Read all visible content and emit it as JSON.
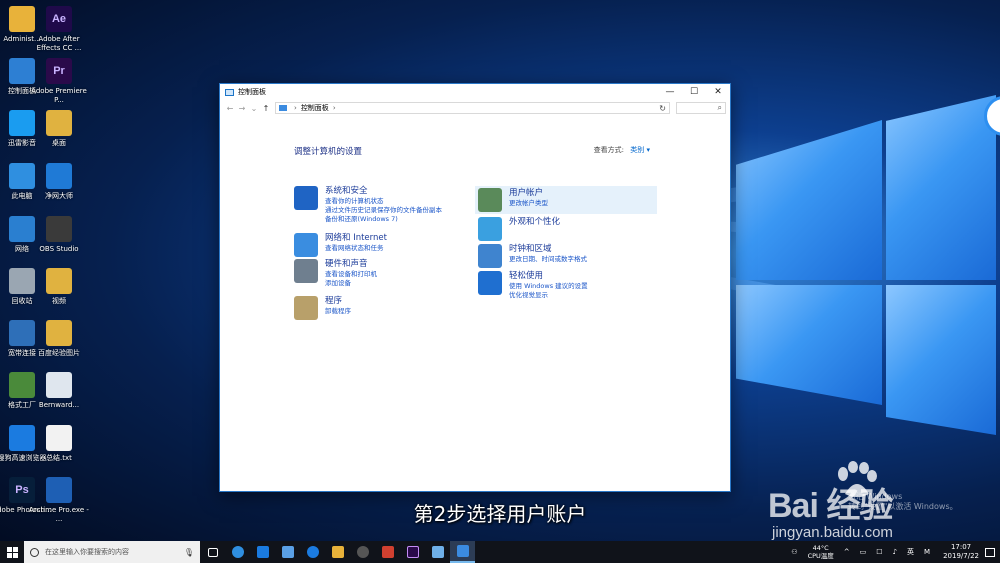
{
  "desktop": {
    "icons": [
      {
        "label": "Administ...",
        "color": "#e8b23a"
      },
      {
        "label": "Adobe After Effects CC ...",
        "glyph": "Ae",
        "color": "#1f0a4a"
      },
      {
        "label": "控制面板",
        "color": "#2d7fd3"
      },
      {
        "label": "Adobe Premiere P...",
        "glyph": "Pr",
        "color": "#2a0a4a"
      },
      {
        "label": "迅雷影音",
        "color": "#1a9cf0"
      },
      {
        "label": "桌面",
        "color": "#e0b240"
      },
      {
        "label": "此电脑",
        "color": "#2f8fe0"
      },
      {
        "label": "净网大师",
        "color": "#1f7ad6"
      },
      {
        "label": "网络",
        "color": "#2a7fd0"
      },
      {
        "label": "OBS Studio",
        "color": "#3a3a3a"
      },
      {
        "label": "回收站",
        "color": "#9aa6b2"
      },
      {
        "label": "视频",
        "color": "#e0b240"
      },
      {
        "label": "宽带连接",
        "color": "#2e6fb8"
      },
      {
        "label": "百度经验图片",
        "color": "#e0b240"
      },
      {
        "label": "格式工厂",
        "color": "#4a8a3a"
      },
      {
        "label": "Bernward...",
        "color": "#dfe6ee"
      },
      {
        "label": "搜狗高速浏览器",
        "color": "#1b7be0"
      },
      {
        "label": "总结.txt",
        "color": "#f2f2f2"
      },
      {
        "label": "Adobe Photosh...",
        "glyph": "Ps",
        "color": "#061e3a"
      },
      {
        "label": "Arctime Pro.exe - ...",
        "color": "#1e5fb4"
      }
    ]
  },
  "window": {
    "title": "控制面板",
    "controls": {
      "minimize": "—",
      "maximize": "☐",
      "close": "✕"
    },
    "address": {
      "path": "控制面板",
      "refresh": "↻",
      "search_glyph": "⌕"
    },
    "heading": "调整计算机的设置",
    "view_by": {
      "label": "查看方式:",
      "value": "类别 ▾"
    },
    "categories_left": [
      {
        "title": "系统和安全",
        "links": [
          "查看你的计算机状态",
          "通过文件历史记录保存你的文件备份副本",
          "备份和还原(Windows 7)"
        ],
        "color": "#1f64c4"
      },
      {
        "title": "网络和 Internet",
        "links": [
          "查看网络状态和任务"
        ],
        "color": "#3a8de0"
      },
      {
        "title": "硬件和声音",
        "links": [
          "查看设备和打印机",
          "添加设备"
        ],
        "color": "#6f7f8f"
      },
      {
        "title": "程序",
        "links": [
          "卸载程序"
        ],
        "color": "#b8a06a"
      }
    ],
    "categories_right": [
      {
        "title": "用户帐户",
        "links": [
          "更改帐户类型"
        ],
        "color": "#5a8a5a"
      },
      {
        "title": "外观和个性化",
        "links": [],
        "color": "#3aa0e0"
      },
      {
        "title": "时钟和区域",
        "links": [
          "更改日期、时间或数字格式"
        ],
        "color": "#3f84cf"
      },
      {
        "title": "轻松使用",
        "links": [
          "使用 Windows 建议的设置",
          "优化视觉显示"
        ],
        "color": "#1f6fd0"
      }
    ]
  },
  "overlay": {
    "subtitle": "第2步选择用户账户",
    "watermark_brand": "Bai 经验",
    "watermark_url": "jingyan.baidu.com",
    "activate_windows": "激活 Windows\n转到\"设置\"以激活 Windows。"
  },
  "taskbar": {
    "search_placeholder": "在这里输入你要搜索的内容",
    "temp": "44°C",
    "cpu_label": "CPU温度",
    "ime": "英",
    "time": "17:07",
    "date": "2019/7/22"
  }
}
